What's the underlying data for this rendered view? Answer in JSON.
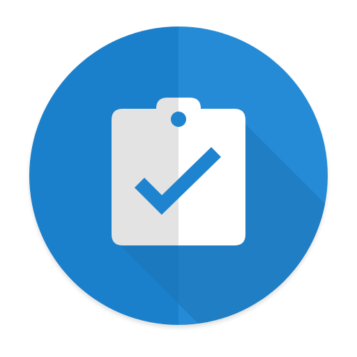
{
  "icon": {
    "name": "clipboard-check-icon",
    "colors": {
      "circle_left": "#1b80cb",
      "circle_right": "#268bd6",
      "long_shadow": "#1c74b6",
      "clipboard_left": "#e3e3e3",
      "clipboard_right": "#ffffff",
      "checkmark": "#1f84cf",
      "clip_hole": "#1f84cf",
      "edge_shadow": "#c9c9c9"
    }
  }
}
